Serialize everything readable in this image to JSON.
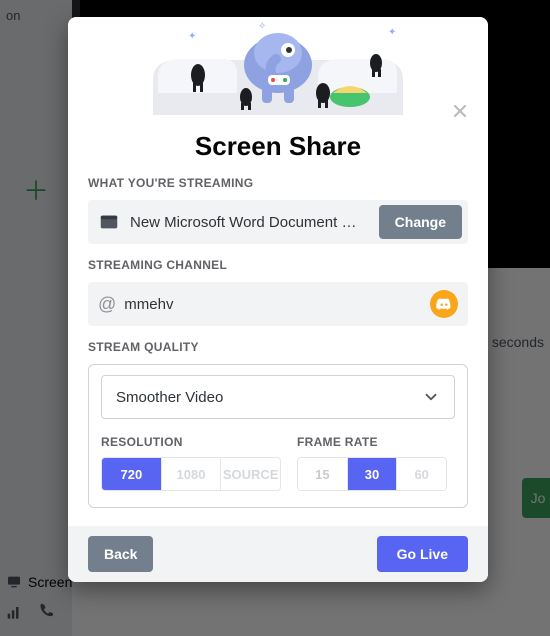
{
  "background": {
    "server_name_truncated": "on",
    "seconds_text": "seconds",
    "go_live_right": "Jo",
    "screen_label": "Screen"
  },
  "modal": {
    "title": "Screen Share",
    "sections": {
      "streaming_app_label": "WHAT YOU'RE STREAMING",
      "streaming_channel_label": "STREAMING CHANNEL",
      "stream_quality_label": "STREAM QUALITY"
    },
    "app": {
      "name": "New Microsoft Word Document …",
      "change_button": "Change"
    },
    "channel": {
      "at_symbol": "@",
      "name": "mmehv"
    },
    "quality": {
      "dropdown_label": "Smoother Video",
      "resolution_label": "RESOLUTION",
      "framerate_label": "FRAME RATE",
      "resolution_options": [
        "720",
        "1080",
        "SOURCE"
      ],
      "resolution_selected_index": 0,
      "framerate_options": [
        "15",
        "30",
        "60"
      ],
      "framerate_selected_index": 1
    },
    "footer": {
      "back": "Back",
      "go_live": "Go Live"
    }
  }
}
